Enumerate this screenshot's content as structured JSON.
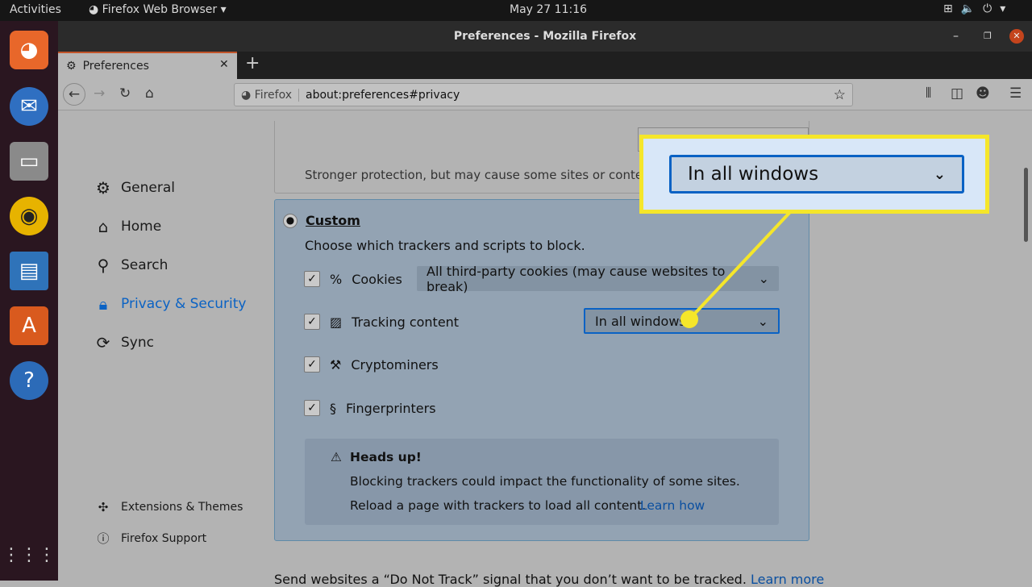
{
  "topbar": {
    "activities": "Activities",
    "app_menu": "Firefox Web Browser",
    "clock": "May 27  11:16"
  },
  "window": {
    "title": "Preferences - Mozilla Firefox"
  },
  "tab": {
    "label": "Preferences"
  },
  "urlbar": {
    "identity": "Firefox",
    "url": "about:preferences#privacy"
  },
  "sidebar": {
    "items": [
      {
        "label": "General",
        "icon": "gear-icon"
      },
      {
        "label": "Home",
        "icon": "home-icon"
      },
      {
        "label": "Search",
        "icon": "search-icon"
      },
      {
        "label": "Privacy & Security",
        "icon": "lock-icon",
        "active": true
      },
      {
        "label": "Sync",
        "icon": "sync-icon"
      }
    ],
    "footer": [
      {
        "label": "Extensions & Themes"
      },
      {
        "label": "Firefox Support"
      }
    ]
  },
  "strict": {
    "description": "Stronger protection, but may cause some sites or content to break."
  },
  "custom": {
    "label": "Custom",
    "description": "Choose which trackers and scripts to block.",
    "options": [
      {
        "label": "Cookies",
        "checked": true,
        "value": "All third-party cookies (may cause websites to break)"
      },
      {
        "label": "Tracking content",
        "checked": true,
        "value": "In all windows"
      },
      {
        "label": "Cryptominers",
        "checked": true
      },
      {
        "label": "Fingerprinters",
        "checked": true
      }
    ],
    "warning": {
      "title": "Heads up!",
      "line1": "Blocking trackers could impact the functionality of some sites.",
      "line2": "Reload a page with trackers to load all content.",
      "link": "Learn how"
    }
  },
  "dnt": {
    "text": "Send websites a “Do Not Track” signal that you don’t want to be tracked.",
    "link": "Learn more"
  },
  "callout": {
    "value": "In all windows",
    "color": "#f5e62a"
  },
  "colors": {
    "accent": "#0a62c4",
    "highlight": "#f5e62a"
  }
}
